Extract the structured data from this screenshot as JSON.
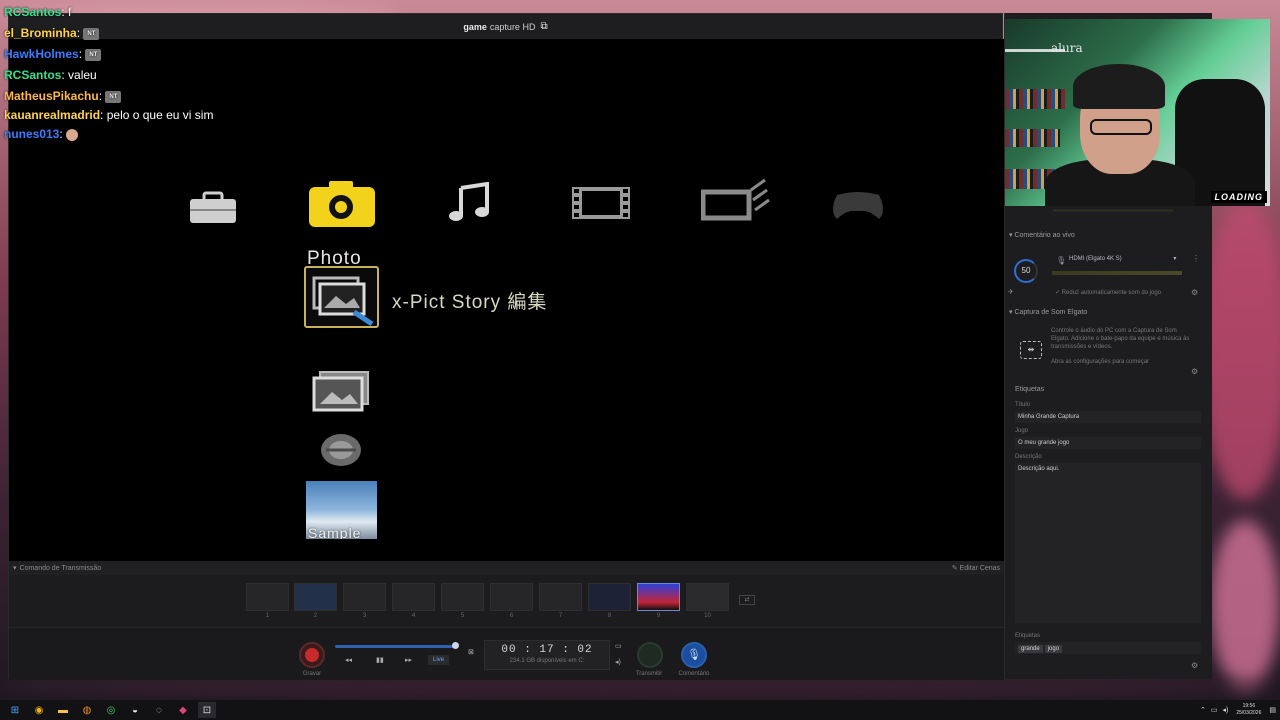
{
  "window": {
    "brand": "game",
    "brand_sub": "capture HD",
    "title_icon": "record-screen-icon"
  },
  "chat": [
    {
      "user": "RCSantos",
      "color": "#38e08f",
      "message": "f",
      "emote": ""
    },
    {
      "user": "el_Brominha",
      "color": "#ffd34d",
      "message": "",
      "emote": "NT"
    },
    {
      "user": "HawkHolmes",
      "color": "#3b7cff",
      "message": "",
      "emote": "NT"
    },
    {
      "user": "RCSantos",
      "color": "#38e08f",
      "message": "valeu",
      "emote": ""
    },
    {
      "user": "MatheusPikachu",
      "color": "#ffb84d",
      "message": "",
      "emote": "NT"
    },
    {
      "user": "kauanrealmadrid",
      "color": "#ffd34d",
      "message": "pelo o que eu vi sim",
      "emote": ""
    },
    {
      "user": "nunes013",
      "color": "#3b7cff",
      "message": "",
      "emote": "face"
    }
  ],
  "xmb": {
    "categories": [
      "settings-icon",
      "photo-icon",
      "music-icon",
      "video-icon",
      "network-icon",
      "game-icon"
    ],
    "selected_label": "Photo",
    "items": [
      {
        "icon": "xpict-story-icon",
        "label": "x-Pict Story 編集"
      },
      {
        "icon": "photo-folder-icon",
        "label": ""
      },
      {
        "icon": "photo-disc-icon",
        "label": ""
      },
      {
        "icon": "sample-photo-icon",
        "label": "Sample"
      }
    ]
  },
  "scenes": {
    "header": "Comando de Transmissão",
    "edit_label": "Editar Cenas",
    "numbers": [
      "1",
      "2",
      "3",
      "4",
      "5",
      "6",
      "7",
      "8",
      "9",
      "10"
    ]
  },
  "transport": {
    "record_label": "Gravar",
    "live_label": "Live",
    "timer": "00 : 17 : 02",
    "disk": "234.1 GB disponíveis em C:",
    "transmit_label": "Transmitir",
    "comment_label": "Comentário"
  },
  "right_panel": {
    "live_commentary": "Comentário ao vivo",
    "device": "HDMI (Elgato 4K S)",
    "volume": "50",
    "auto_reduce": "Reduz automaticamente som do jogo",
    "elgato_sound": "Captura de Som Elgato",
    "elgato_desc": "Controle o áudio do PC com a Captura de Som Elgato. Adicione o bate-papo da equipe e música às transmissões e vídeos.",
    "elgato_hint": "Abra as configurações para começar",
    "tags_title": "Etiquetas",
    "title_label": "Título",
    "title_value": "Minha Grande Captura",
    "game_label": "Jogo",
    "game_value": "O meu grande jogo",
    "desc_label": "Descrição",
    "desc_value": "Descrição aqui.",
    "tags_label": "Etiquetas",
    "tags": [
      "grande",
      "jogo"
    ]
  },
  "webcam": {
    "logo": "LOADING",
    "brand": "alura"
  },
  "taskbar": {
    "apps": [
      "windows-start-icon",
      "chrome-icon",
      "file-explorer-icon",
      "discord-icon",
      "whatsapp-icon",
      "steam-icon",
      "obs-icon",
      "app-pink-icon",
      "game-capture-icon"
    ],
    "time": "19:56",
    "date": "25/03/2026"
  }
}
